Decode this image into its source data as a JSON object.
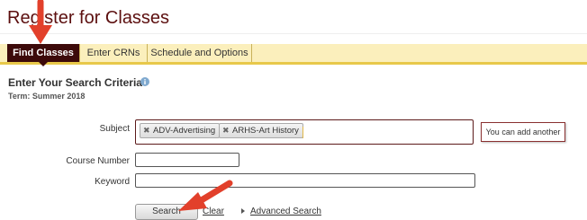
{
  "page": {
    "title": "Register for Classes"
  },
  "tabs": [
    {
      "label": "Find Classes",
      "active": true
    },
    {
      "label": "Enter CRNs",
      "active": false
    },
    {
      "label": "Schedule and Options",
      "active": false
    }
  ],
  "search": {
    "heading": "Enter Your Search Criteria",
    "term": "Term: Summer 2018",
    "subject_label": "Subject",
    "subject_chips": [
      "ADV-Advertising",
      "ARHS-Art History"
    ],
    "subject_hint": "You can add another",
    "course_number_label": "Course Number",
    "course_number_value": "",
    "keyword_label": "Keyword",
    "keyword_value": "",
    "search_button": "Search",
    "clear_link": "Clear",
    "advanced_search_link": "Advanced Search"
  },
  "colors": {
    "brand": "#5c0f0f",
    "active_tab": "#3d0a0a",
    "tabbar_bg": "#fbefbc",
    "tabbar_accent": "#e8c84a",
    "annotation_arrow": "#e2402b",
    "info_icon": "#7fa9cf"
  },
  "icons": {
    "info": "info-icon",
    "chip_remove": "close-icon",
    "advanced_toggle": "caret-right-icon",
    "annotation": "arrow-annotation"
  }
}
